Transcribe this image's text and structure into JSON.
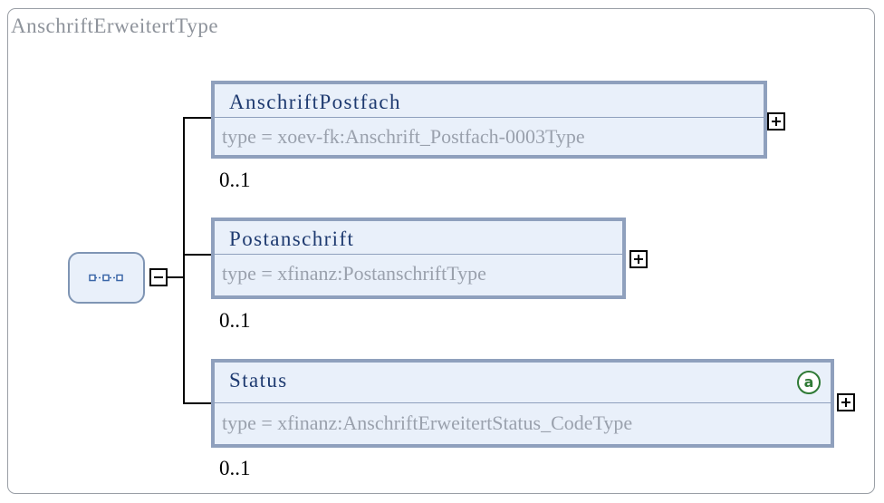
{
  "diagram": {
    "title": "AnschriftErweitertType",
    "sequence_icon": "sequence-icon",
    "elements": [
      {
        "name": "AnschriftPostfach",
        "type_label": "type = xoev-fk:Anschrift_Postfach-0003Type",
        "cardinality": "0..1",
        "expand_icon": "plus-icon"
      },
      {
        "name": "Postanschrift",
        "type_label": "type = xfinanz:PostanschriftType",
        "cardinality": "0..1",
        "expand_icon": "plus-icon"
      },
      {
        "name": "Status",
        "type_label": "type = xfinanz:AnschriftErweitertStatus_CodeType",
        "cardinality": "0..1",
        "expand_icon": "plus-icon",
        "attribute_icon": "at-sign-icon",
        "attribute_glyph": "a"
      }
    ],
    "colors": {
      "box_fill": "#e9f0fa",
      "box_border": "#8fa0bd",
      "name_text": "#1e3a70",
      "type_text": "#9aa1ad",
      "attribute_icon": "#2f7a36"
    }
  }
}
